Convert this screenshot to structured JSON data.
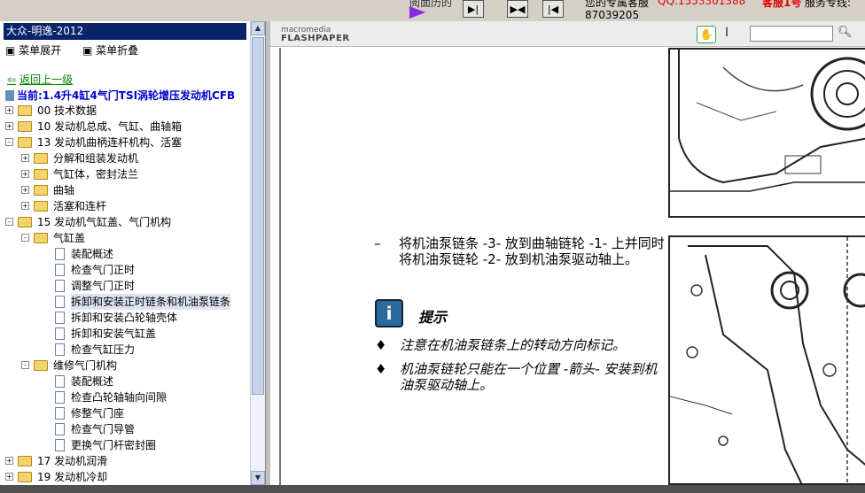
{
  "topbar": {
    "prev_label": "阅面历的",
    "contact_label": "您的专属客服",
    "qq": "QQ:1553301388",
    "service": "客服1号",
    "service_suffix": "服务专线:",
    "phone": "87039205",
    "accent_purple": "#8a2be2"
  },
  "tree": {
    "title": "大众-明逸-2012",
    "expand_all": "菜单展开",
    "collapse_all": "菜单折叠",
    "back": "返回上一级",
    "current": "当前:1.4升4缸4气门TSI涡轮增压发动机CFB",
    "nodes": [
      {
        "label": "00 技术数据"
      },
      {
        "label": "10 发动机总成、气缸、曲轴箱"
      },
      {
        "label": "13 发动机曲柄连杆机构、活塞"
      },
      {
        "label": "分解和组装发动机"
      },
      {
        "label": "气缸体，密封法兰"
      },
      {
        "label": "曲轴"
      },
      {
        "label": "活塞和连杆"
      },
      {
        "label": "15 发动机气缸盖、气门机构"
      },
      {
        "label": "气缸盖"
      },
      {
        "label": "装配概述"
      },
      {
        "label": "检查气门正时"
      },
      {
        "label": "调整气门正时"
      },
      {
        "label": "拆卸和安装正时链条和机油泵链条"
      },
      {
        "label": "拆卸和安装凸轮轴壳体"
      },
      {
        "label": "拆卸和安装气缸盖"
      },
      {
        "label": "检查气缸压力"
      },
      {
        "label": "维修气门机构"
      },
      {
        "label": "装配概述"
      },
      {
        "label": "检查凸轮轴轴向间隙"
      },
      {
        "label": "修整气门座"
      },
      {
        "label": "检查气门导管"
      },
      {
        "label": "更换气门杆密封圈"
      },
      {
        "label": "17 发动机润滑"
      },
      {
        "label": "19 发动机冷却"
      }
    ]
  },
  "viewer": {
    "logo_top": "macromedia",
    "logo_main": "FLASHPAPER",
    "search_placeholder": "",
    "instruction": "将机油泵链条 -3- 放到曲轴链轮 -1- 上并同时将机油泵链轮 -2- 放到机油泵驱动轴上。",
    "note_title": "提示",
    "note_icon_letter": "i",
    "bullet1": "注意在机油泵链条上的转动方向标记。",
    "bullet2": "机油泵链轮只能在一个位置 -箭头- 安装到机油泵驱动轴上。",
    "dash": "–",
    "bullet_mark": "♦"
  }
}
